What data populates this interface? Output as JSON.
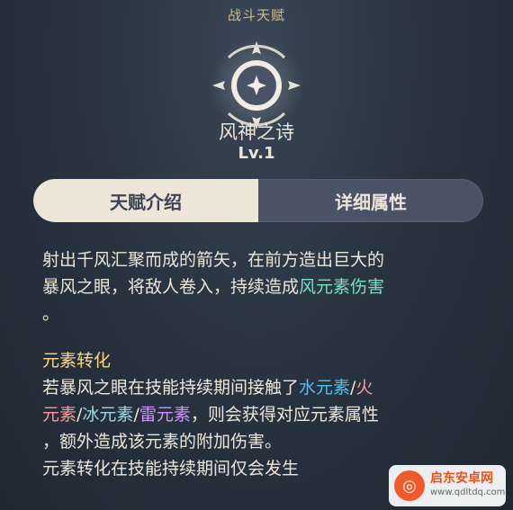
{
  "section_title": "战斗天赋",
  "talent": {
    "name": "风神之诗",
    "level": "Lv.1"
  },
  "tabs": [
    {
      "label": "天赋介绍",
      "active": true
    },
    {
      "label": "详细属性",
      "active": false
    }
  ],
  "description": {
    "line1": "射出千风汇聚而成的箭矢，在前方造出巨大的",
    "line2_a": "暴风之眼，将敌人卷入，持续造成",
    "line2_hl": "风元素伤害",
    "line3": "。"
  },
  "conversion": {
    "heading": "元素转化",
    "l1_a": "若暴风之眼在技能持续期间接触了",
    "hydro": "水元素",
    "slash1": "/",
    "pyro_a": "火",
    "pyro_b": "元素",
    "slash2": "/",
    "cryo": "冰元素",
    "slash3": "/",
    "electro": "雷元素",
    "l2_tail": "，则会获得对应元素属性",
    "l3": "，额外造成该元素的附加伤害。",
    "l4": "元素转化在技能持续期间仅会发生"
  },
  "colors": {
    "anemo": "#72e2c2",
    "hydro": "#4cc2f1",
    "pyro": "#ff9999",
    "cryo": "#9fd6e3",
    "electro": "#d38eff",
    "heading": "#ffd780"
  },
  "watermark": {
    "name": "启东安卓网",
    "url": "www.qdltdq.com"
  }
}
